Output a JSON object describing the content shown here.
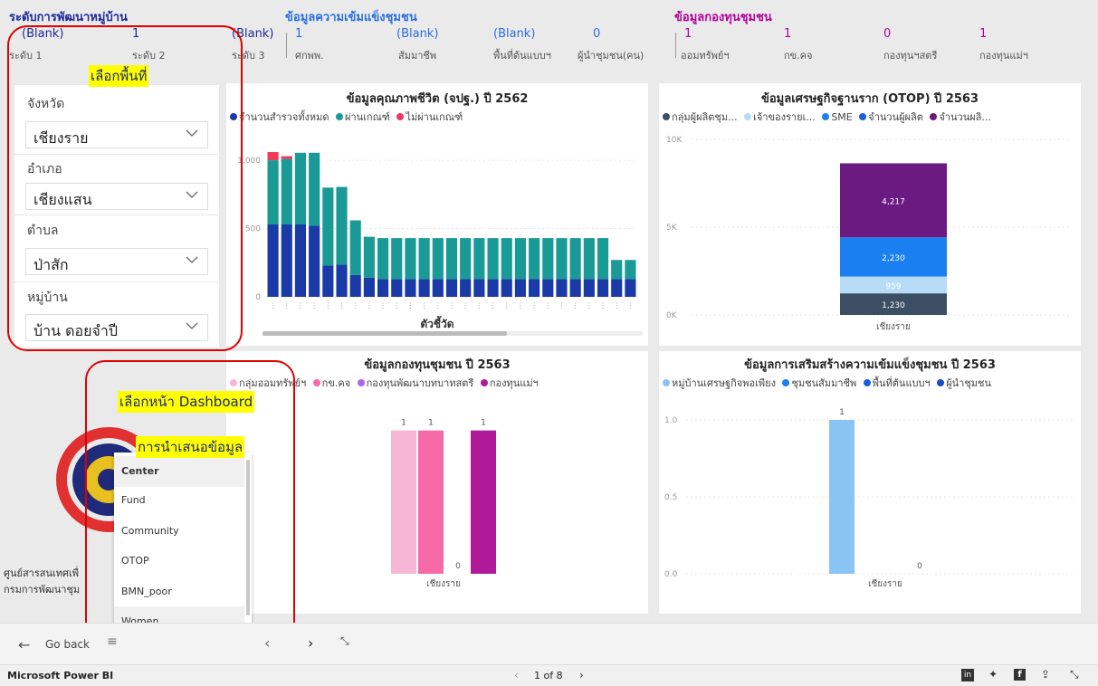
{
  "header": {
    "section1_title": "ระดับการพัฒนาหมู่บ้าน",
    "section2_title": "ข้อมูลความเข้มแข็งชุมชน",
    "section3_title": "ข้อมูลกองทุนชุมชน",
    "kpis": [
      {
        "value": "(Blank)",
        "label": "ระดับ 1"
      },
      {
        "value": "1",
        "label": "ระดับ 2"
      },
      {
        "value": "(Blank)",
        "label": "ระดับ 3"
      },
      {
        "value": "1",
        "label": "ศกพพ."
      },
      {
        "value": "(Blank)",
        "label": "สัมมาชีพ"
      },
      {
        "value": "(Blank)",
        "label": "พื้นที่ต้นแบบฯ"
      },
      {
        "value": "0",
        "label": "ผู้นำชุมชน(คน)"
      },
      {
        "value": "1",
        "label": "ออมทรัพย์ฯ"
      },
      {
        "value": "1",
        "label": "กข.คจ"
      },
      {
        "value": "0",
        "label": "กองทุนฯสตรี"
      },
      {
        "value": "1",
        "label": "กองทุนแม่ฯ"
      }
    ],
    "colors": {
      "level": "#1f2a9a",
      "strength": "#2a6fe0",
      "fund": "#b0009a"
    }
  },
  "slicers": {
    "province": {
      "label": "จังหวัด",
      "value": "เชียงราย"
    },
    "district": {
      "label": "อำเภอ",
      "value": "เชียงแสน"
    },
    "subdistrict": {
      "label": "ตำบล",
      "value": "ป่าสัก"
    },
    "village": {
      "label": "หมู่บ้าน",
      "value": "บ้าน ดอยจำปี"
    }
  },
  "annotations": {
    "select_area": "เลือกพื้นที่",
    "select_dashboard": "เลือกหน้า Dashboard",
    "presentation": "การนำเสนอข้อมูล"
  },
  "logo": {
    "line1": "ศูนย์สารสนเทศเพื่",
    "line2": "กรมการพัฒนาชุม"
  },
  "menu": {
    "items": [
      "Center",
      "Fund",
      "Community",
      "OTOP",
      "BMN_poor",
      "Women"
    ],
    "selected": "Center"
  },
  "navbar": {
    "back": "Go back"
  },
  "footer": {
    "brand": "Microsoft Power BI",
    "page": "1 of 8"
  },
  "chart_data": [
    {
      "type": "bar",
      "title": "ข้อมูลคุณภาพชีวิต (จปฐ.) ปี 2562",
      "xlabel": "ตัวชี้วัด",
      "ylim": [
        0,
        1100
      ],
      "yticks": [
        "1,000",
        "500",
        "0"
      ],
      "stacked": true,
      "categories": [
        "1",
        "2",
        "3",
        "4",
        "5",
        "6",
        "7",
        "8",
        "9",
        "10",
        "11",
        "12",
        "13",
        "14",
        "15",
        "16",
        "17",
        "18",
        "19",
        "20",
        "21",
        "22",
        "23",
        "24",
        "25",
        "26",
        "27"
      ],
      "series": [
        {
          "name": "จำนวนสำรวจทั้งหมด",
          "color": "#1a3aa8",
          "values": [
            530,
            530,
            530,
            520,
            230,
            235,
            160,
            140,
            130,
            130,
            130,
            130,
            130,
            130,
            130,
            130,
            130,
            130,
            130,
            130,
            130,
            130,
            130,
            130,
            130,
            130,
            130
          ]
        },
        {
          "name": "ผ่านเกณฑ์",
          "color": "#1a9a96",
          "values": [
            470,
            480,
            525,
            535,
            570,
            570,
            400,
            300,
            300,
            300,
            300,
            300,
            300,
            300,
            300,
            300,
            300,
            300,
            300,
            300,
            300,
            300,
            300,
            300,
            300,
            140,
            140
          ]
        },
        {
          "name": "ไม่ผ่านเกณฑ์",
          "color": "#f03a5a",
          "values": [
            60,
            20,
            0,
            0,
            0,
            0,
            0,
            0,
            0,
            0,
            0,
            0,
            0,
            0,
            0,
            0,
            0,
            0,
            0,
            0,
            0,
            0,
            0,
            0,
            0,
            0,
            0
          ]
        }
      ]
    },
    {
      "type": "bar",
      "title": "ข้อมูลเศรษฐกิจฐานราก (OTOP) ปี 2563",
      "stacked": true,
      "ylim": [
        0,
        10000
      ],
      "yticks": [
        "10K",
        "5K",
        "0K"
      ],
      "categories": [
        "เชียงราย"
      ],
      "series": [
        {
          "name": "กลุ่มผู้ผลิตชุม...",
          "color": "#3b4e63",
          "values": [
            1230
          ]
        },
        {
          "name": "เจ้าของรายเ...",
          "color": "#b7dcf7",
          "values": [
            959
          ]
        },
        {
          "name": "SME",
          "color": "#1a7ff0",
          "values": [
            2230
          ]
        },
        {
          "name": "จำนวนผู้ผลิต",
          "color": "#1a5ee0",
          "values": [
            0
          ]
        },
        {
          "name": "จำนวนผลิ...",
          "color": "#6a1a80",
          "values": [
            4217
          ]
        }
      ],
      "data_labels": [
        "1,230",
        "959",
        "2,230",
        "4,217"
      ]
    },
    {
      "type": "bar",
      "title": "ข้อมูลกองทุนชุมชน ปี 2563",
      "ylim": [
        0,
        1.2
      ],
      "categories": [
        "เชียงราย"
      ],
      "series": [
        {
          "name": "กลุ่มออมทรัพย์ฯ",
          "color": "#f7b6d6",
          "values": [
            1
          ]
        },
        {
          "name": "กข.คจ",
          "color": "#f76aa8",
          "values": [
            1
          ]
        },
        {
          "name": "กองทุนพัฒนาบทบาทสตรี",
          "color": "#a86af0",
          "values": [
            0
          ]
        },
        {
          "name": "กองทุนแม่ฯ",
          "color": "#b01a9a",
          "values": [
            1
          ]
        }
      ]
    },
    {
      "type": "bar",
      "title": "ข้อมูลการเสริมสร้างความเข้มแข็งชุมชน ปี 2563",
      "ylim": [
        0,
        1.2
      ],
      "yticks": [
        "1.0",
        "0.5",
        "0.0"
      ],
      "categories": [
        "เชียงราย"
      ],
      "series": [
        {
          "name": "หมู่บ้านเศรษฐกิจพอเพียง",
          "color": "#8ac4f5",
          "values": [
            1
          ]
        },
        {
          "name": "ชุมชนสัมมาชีพ",
          "color": "#1a7ff0",
          "values": [
            0
          ]
        },
        {
          "name": "พื้นที่ต้นแบบฯ",
          "color": "#1a5ee0",
          "values": [
            0
          ]
        },
        {
          "name": "ผู้นำชุมชน",
          "color": "#1a4ec0",
          "values": [
            0
          ]
        }
      ]
    }
  ]
}
